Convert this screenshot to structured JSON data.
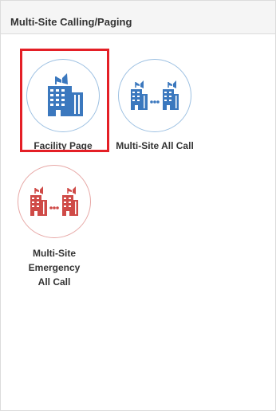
{
  "panel": {
    "title": "Multi-Site Calling/Paging"
  },
  "tiles": [
    {
      "label": "Facility Page",
      "icon": "building-with-horn-icon",
      "accent": "#3b78be",
      "selected": true
    },
    {
      "label": "Multi-Site All Call",
      "icon": "multi-building-icon",
      "accent": "#3b78be",
      "selected": false
    },
    {
      "label_lines": [
        "Multi-Site",
        "Emergency",
        "All Call"
      ],
      "icon": "multi-building-emergency-icon",
      "accent": "#cf4a47",
      "selected": false
    }
  ],
  "colors": {
    "selection_border": "#e41f26",
    "blue_icon": "#3b78be",
    "red_icon": "#cf4a47"
  }
}
